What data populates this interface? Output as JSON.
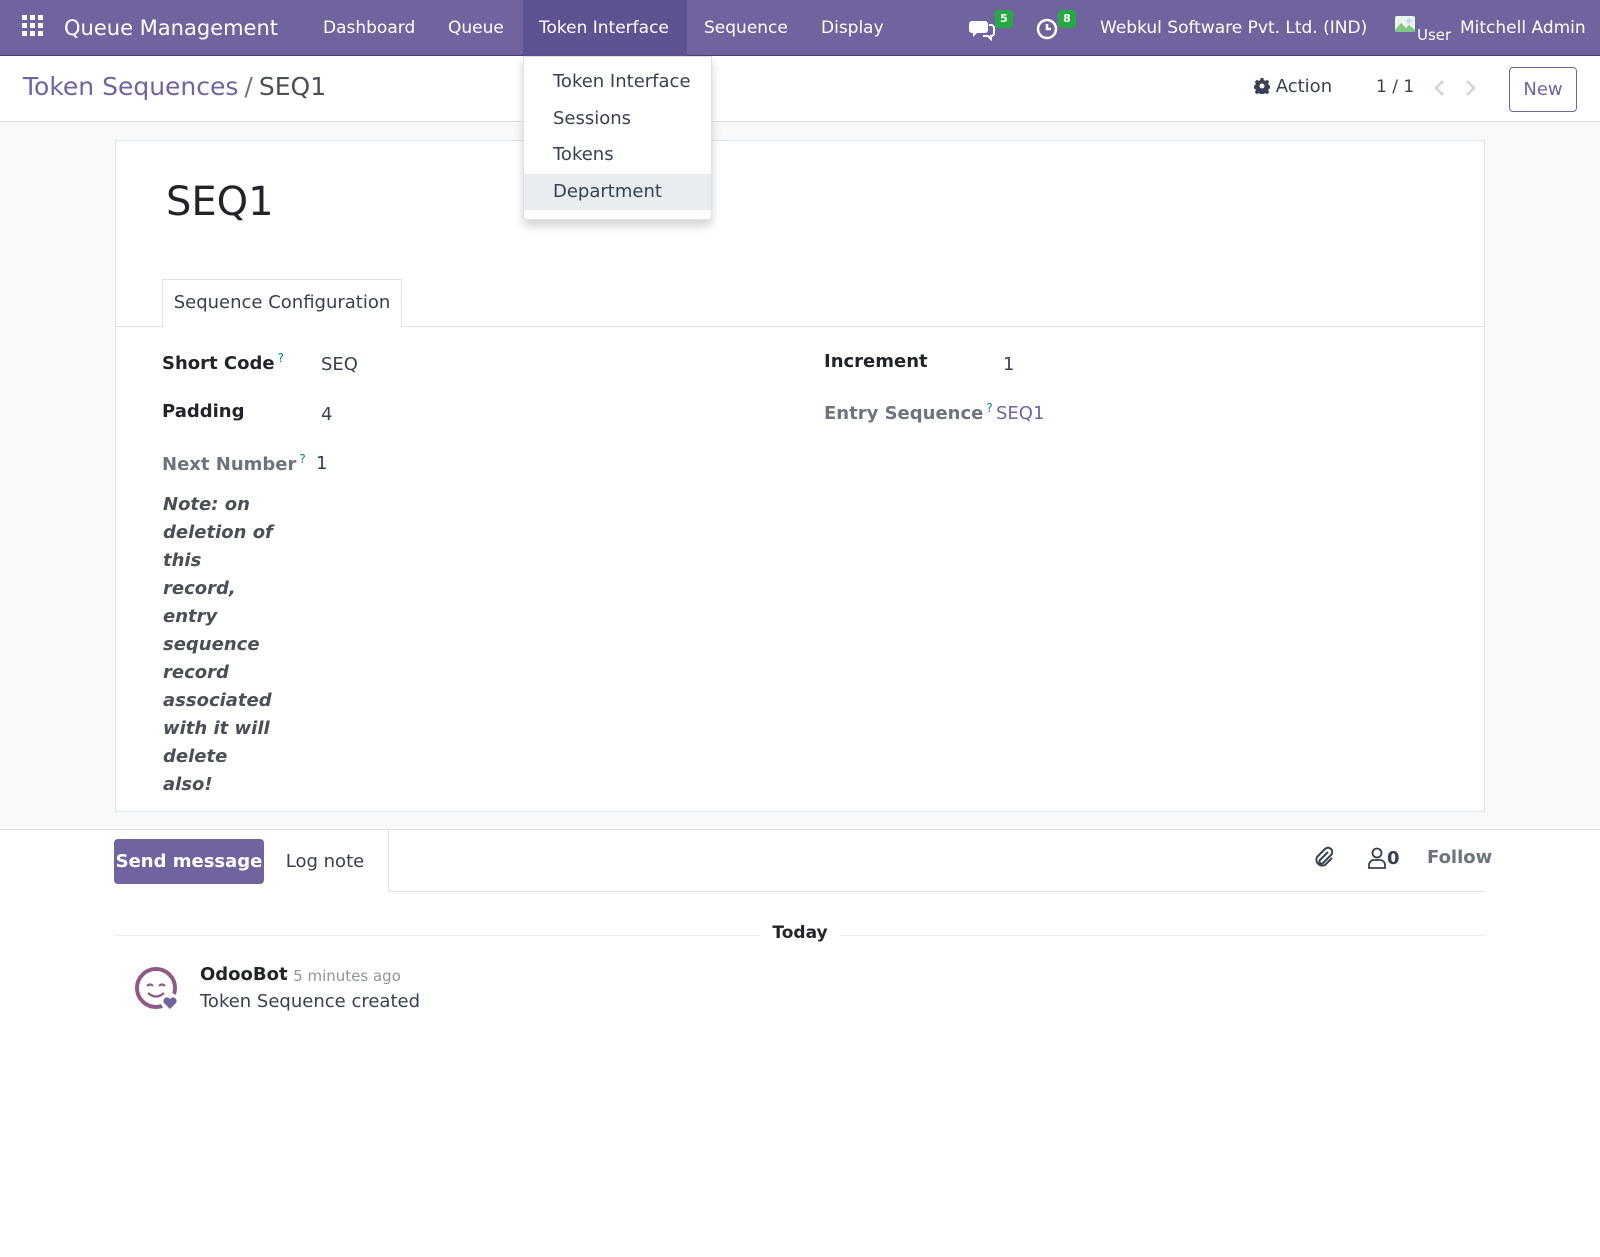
{
  "navbar": {
    "app_name": "Queue Management",
    "menus": [
      "Dashboard",
      "Queue",
      "Token Interface",
      "Sequence",
      "Display"
    ],
    "messages_badge": "5",
    "activities_badge": "8",
    "company": "Webkul Software Pvt. Ltd. (IND)",
    "avatar_alt": "User",
    "user": "Mitchell Admin",
    "accent_color": "#71639e"
  },
  "dropdown": {
    "items": [
      "Token Interface",
      "Sessions",
      "Tokens",
      "Department"
    ]
  },
  "control_panel": {
    "breadcrumb_parent": "Token Sequences",
    "breadcrumb_separator": "/",
    "breadcrumb_current": "SEQ1",
    "action_label": "Action",
    "pager": "1 / 1",
    "new_label": "New"
  },
  "form": {
    "title": "SEQ1",
    "tab_label": "Sequence Configuration",
    "short_code_label": "Short Code",
    "short_code_value": "SEQ",
    "padding_label": "Padding",
    "padding_value": "4",
    "next_number_label": "Next Number",
    "next_number_value": "1",
    "increment_label": "Increment",
    "increment_value": "1",
    "entry_sequence_label": "Entry Sequence",
    "entry_sequence_value": "SEQ1",
    "help_mark": "?",
    "note": "Note: on deletion of this record, entry sequence record associated with it will delete also!"
  },
  "chatter": {
    "send_message": "Send message",
    "log_note": "Log note",
    "follower_count": "0",
    "follow_label": "Follow",
    "date_separator": "Today",
    "message": {
      "author": "OdooBot",
      "date": "- 5 minutes ago",
      "body": "Token Sequence created"
    }
  }
}
